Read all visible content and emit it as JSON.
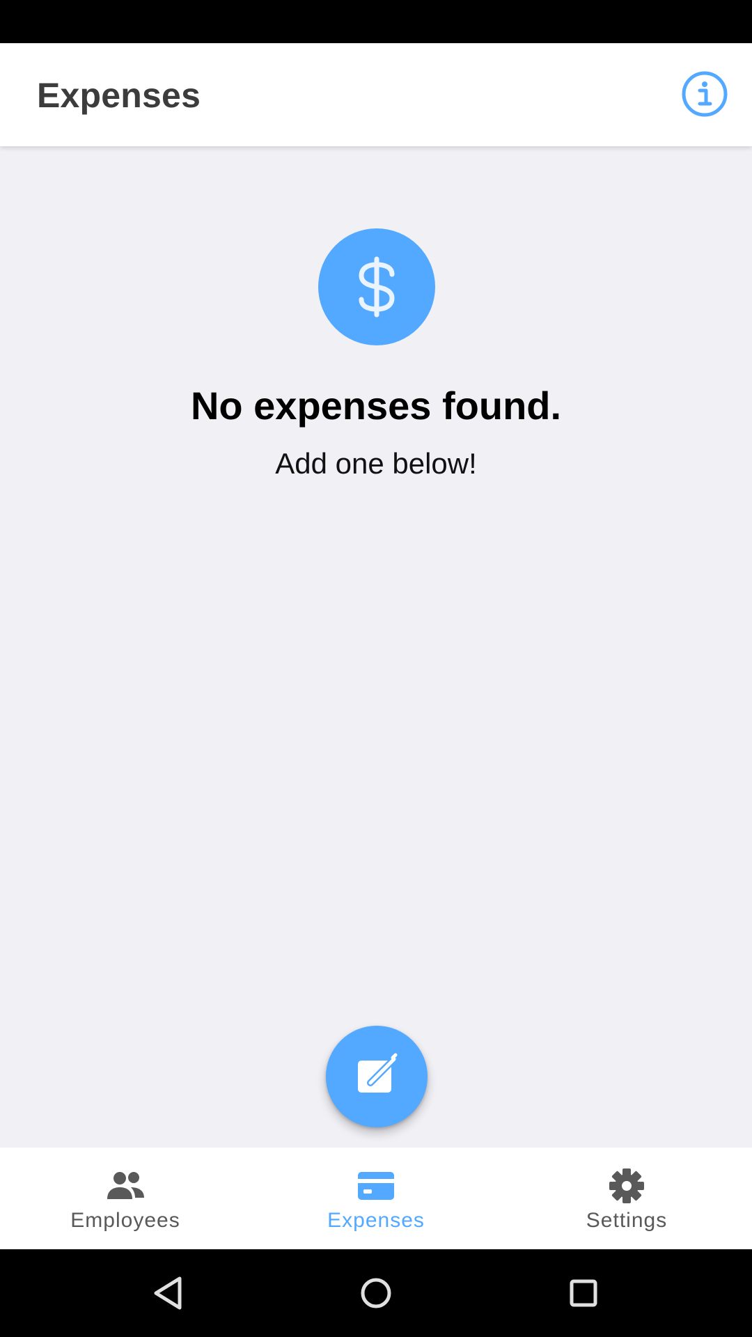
{
  "app_bar": {
    "title": "Expenses",
    "info_icon": "info-circle-icon"
  },
  "empty_state": {
    "icon": "dollar-sign-icon",
    "title": "No expenses found.",
    "subtitle": "Add one below!"
  },
  "fab": {
    "icon": "edit-note-icon"
  },
  "bottom_nav": {
    "items": [
      {
        "label": "Employees",
        "icon": "people-icon",
        "active": false
      },
      {
        "label": "Expenses",
        "icon": "credit-card-icon",
        "active": true
      },
      {
        "label": "Settings",
        "icon": "gear-icon",
        "active": false
      }
    ]
  },
  "system_nav": {
    "back_icon": "back-triangle-icon",
    "home_icon": "home-circle-icon",
    "recents_icon": "recents-square-icon"
  },
  "colors": {
    "accent": "#52a9ff",
    "background": "#f0f0f5",
    "inactive": "#595959"
  }
}
